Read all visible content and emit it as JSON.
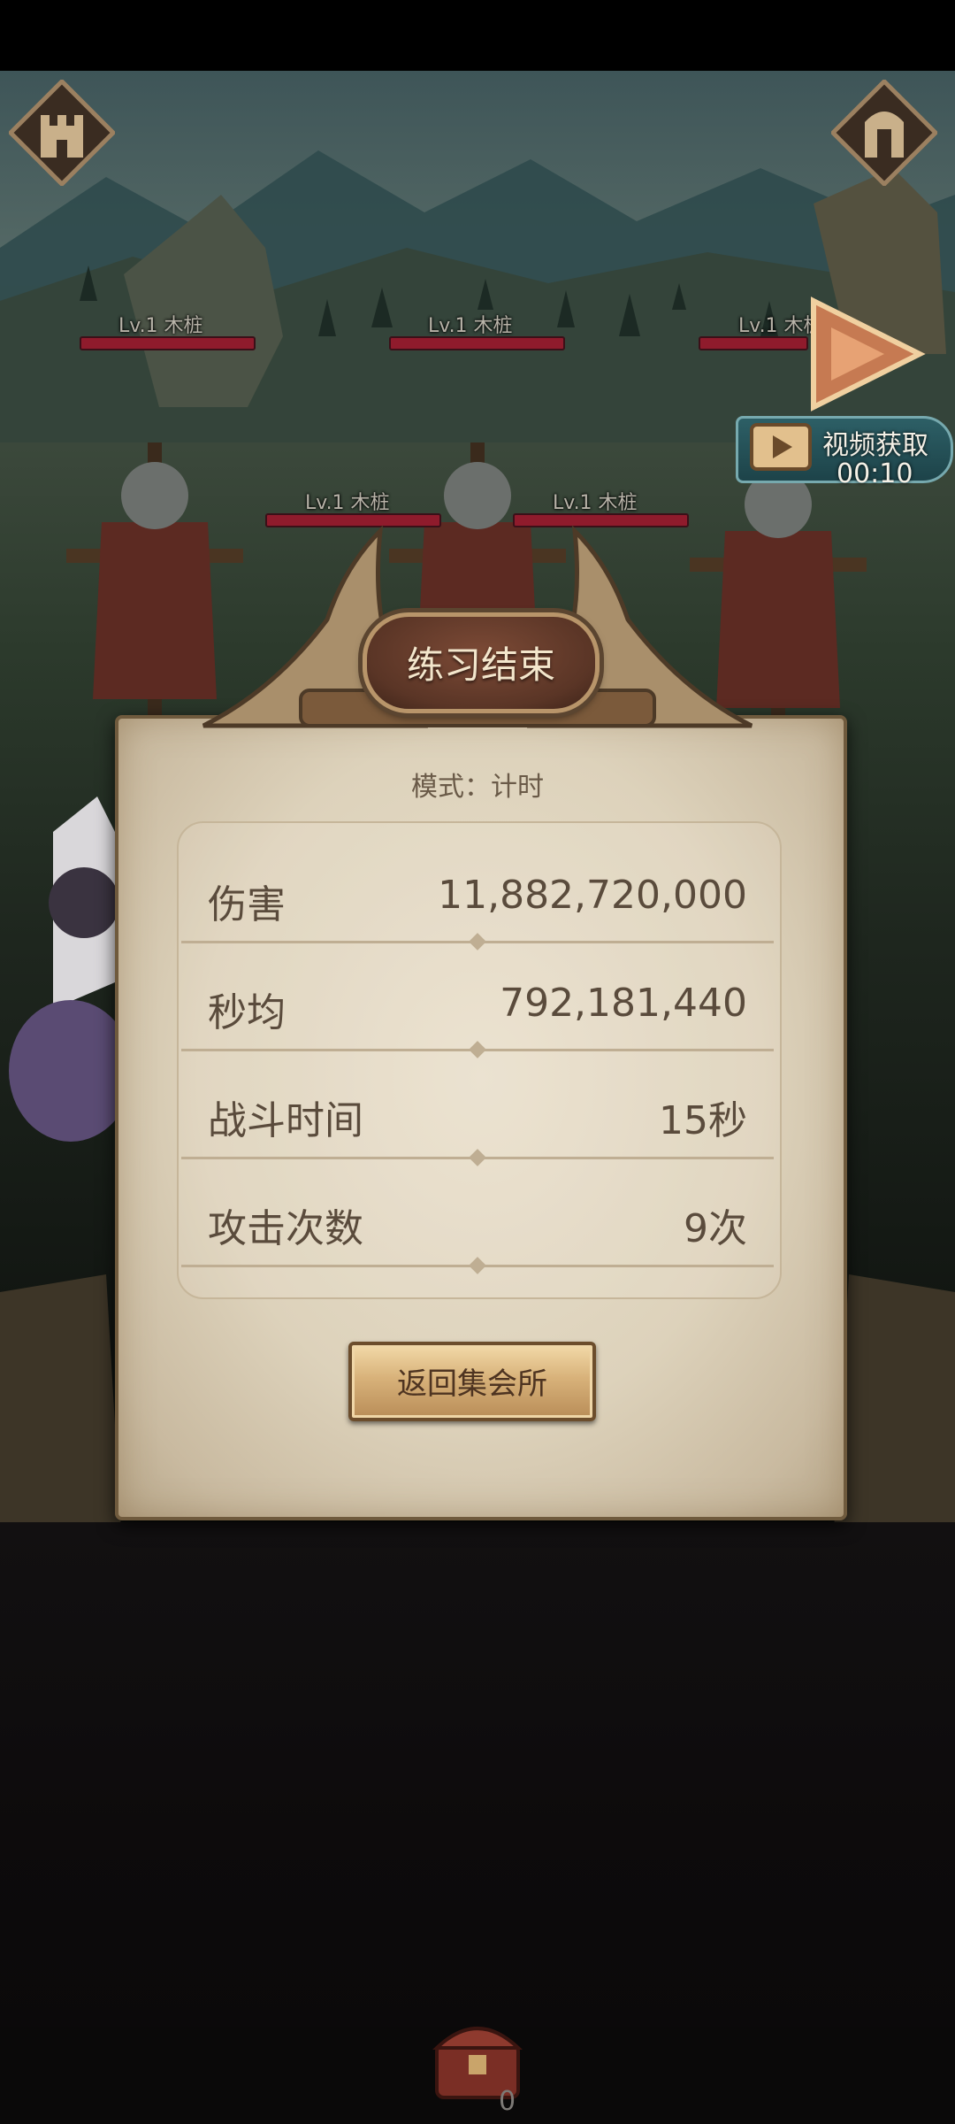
{
  "enemies": [
    {
      "label": "Lv.1  木桩"
    },
    {
      "label": "Lv.1  木桩"
    },
    {
      "label": "Lv.1  木桩"
    },
    {
      "label": "Lv.1  木桩"
    },
    {
      "label": "Lv.1  木桩"
    }
  ],
  "video_reward": {
    "label": "视频获取",
    "timer": "00:10"
  },
  "result_panel": {
    "title": "练习结束",
    "mode": "模式：计时",
    "stats": [
      {
        "label": "伤害",
        "value": "11,882,720,000"
      },
      {
        "label": "秒均",
        "value": "792,181,440"
      },
      {
        "label": "战斗时间",
        "value": "15秒"
      },
      {
        "label": "攻击次数",
        "value": "9次"
      }
    ],
    "return_button": "返回集会所"
  },
  "bottom_bar": {
    "count": "0"
  },
  "colors": {
    "hp_bar": "#8f1b2c",
    "panel": "#e3d9c4",
    "title_plate": "#6b3f2e",
    "button": "#d8b27a",
    "video_button": "#2d5f66"
  },
  "icons": [
    "castle-icon",
    "door-icon",
    "play-arrow-icon",
    "film-icon",
    "treasure-chest-icon"
  ]
}
